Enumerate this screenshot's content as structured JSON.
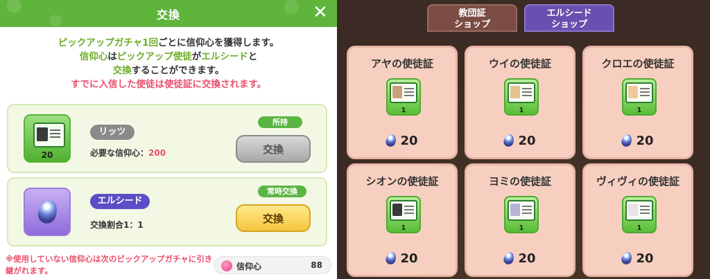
{
  "dialog": {
    "title": "交換",
    "intro": {
      "line1_a": "ピックアップガチャ1回",
      "line1_b": "ごとに信仰心を獲得します。",
      "line2_a": "信仰心",
      "line2_b": "は",
      "line2_c": "ピックアップ使徒",
      "line2_d": "が",
      "line2_e": "エルシード",
      "line2_f": "と",
      "line3_a": "交換",
      "line3_b": "することができます。",
      "line4": "すでに入信した使徒は使徒証に交換されます。"
    },
    "item1": {
      "name": "リッツ",
      "badge": "所持",
      "requirement_label": "必要な信仰心：",
      "requirement_value": "200",
      "count": "20",
      "button": "交換"
    },
    "item2": {
      "name": "エルシード",
      "badge": "常時交換",
      "rate_label": "交換割合1：1",
      "button": "交換"
    },
    "note": "※使用していない信仰心は次のピックアップガチャに引き継がれます。",
    "faith": {
      "label": "信仰心",
      "value": "88"
    }
  },
  "shop": {
    "tabs": [
      {
        "label1": "教団証",
        "label2": "ショップ"
      },
      {
        "label1": "エルシード",
        "label2": "ショップ"
      }
    ],
    "items": [
      {
        "title": "アヤの使徒証",
        "count": "1",
        "price": "20"
      },
      {
        "title": "ウイの使徒証",
        "count": "1",
        "price": "20"
      },
      {
        "title": "クロエの使徒証",
        "count": "1",
        "price": "20"
      },
      {
        "title": "シオンの使徒証",
        "count": "1",
        "price": "20"
      },
      {
        "title": "ヨミの使徒証",
        "count": "1",
        "price": "20"
      },
      {
        "title": "ヴィヴィの使徒証",
        "count": "1",
        "price": "20"
      }
    ]
  },
  "colors": {
    "header_green": "#5fb53b",
    "accent_red": "#e8506c",
    "accent_green_text": "#6cae27",
    "tag_purple": "#5a4fc6",
    "yellow_button": "#f5c640",
    "gray_button": "#a8a8a8"
  }
}
